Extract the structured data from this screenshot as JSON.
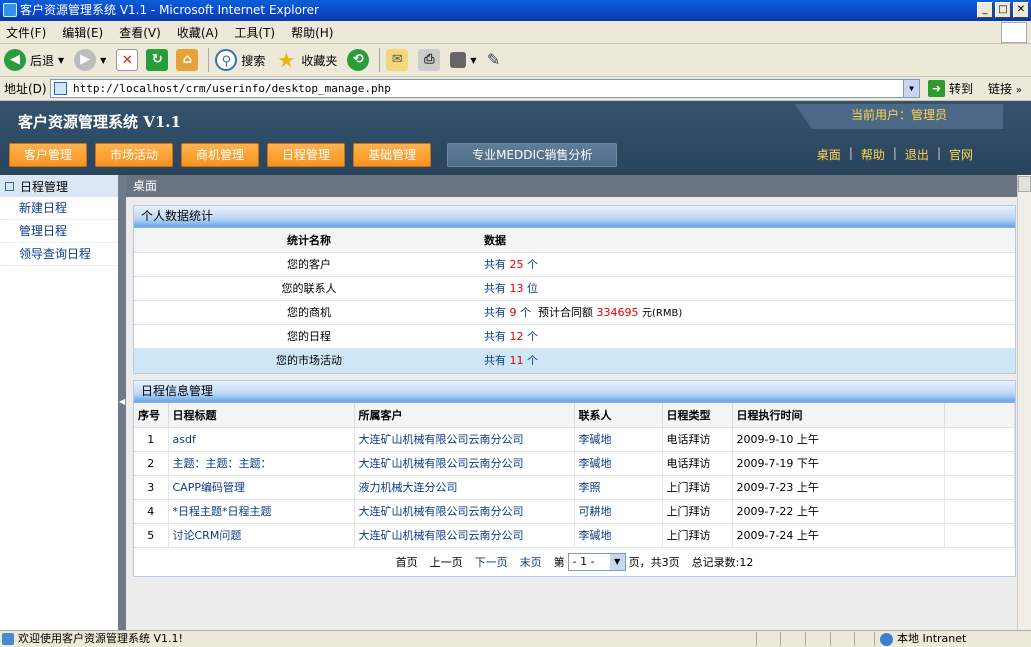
{
  "window": {
    "title": "客户资源管理系统 V1.1 - Microsoft Internet Explorer"
  },
  "menu": [
    "文件(F)",
    "编辑(E)",
    "查看(V)",
    "收藏(A)",
    "工具(T)",
    "帮助(H)"
  ],
  "toolbar": {
    "back": "后退",
    "search": "搜索",
    "favorites": "收藏夹"
  },
  "address": {
    "label": "地址(D)",
    "url": "http://localhost/crm/userinfo/desktop_manage.php",
    "go": "转到",
    "links": "链接"
  },
  "app": {
    "title": "客户资源管理系统 V1.1",
    "current_user": "当前用户：管理员",
    "nav": [
      "客户管理",
      "市场活动",
      "商机管理",
      "日程管理",
      "基础管理",
      "专业MEDDIC销售分析"
    ],
    "top_links": [
      "桌面",
      "帮助",
      "退出",
      "官网"
    ]
  },
  "sidebar": {
    "heading": "日程管理",
    "items": [
      "新建日程",
      "管理日程",
      "领导查询日程"
    ]
  },
  "main": {
    "header": "桌面",
    "stats": {
      "title": "个人数据统计",
      "col_name": "统计名称",
      "col_data": "数据",
      "rows": [
        {
          "name": "您的客户",
          "pre": "共有",
          "num": "25",
          "unit": "个",
          "extra_label": "",
          "extra_value": "",
          "extra_unit": ""
        },
        {
          "name": "您的联系人",
          "pre": "共有",
          "num": "13",
          "unit": "位",
          "extra_label": "",
          "extra_value": "",
          "extra_unit": ""
        },
        {
          "name": "您的商机",
          "pre": "共有",
          "num": "9",
          "unit": "个",
          "extra_label": "预计合同额",
          "extra_value": "334695",
          "extra_unit": "元(RMB)"
        },
        {
          "name": "您的日程",
          "pre": "共有",
          "num": "12",
          "unit": "个",
          "extra_label": "",
          "extra_value": "",
          "extra_unit": ""
        },
        {
          "name": "您的市场活动",
          "pre": "共有",
          "num": "11",
          "unit": "个",
          "extra_label": "",
          "extra_value": "",
          "extra_unit": ""
        }
      ]
    },
    "schedule": {
      "title": "日程信息管理",
      "headers": [
        "序号",
        "日程标题",
        "所属客户",
        "联系人",
        "日程类型",
        "日程执行时间"
      ],
      "rows": [
        {
          "idx": "1",
          "title": "asdf",
          "customer": "大连矿山机械有限公司云南分公司",
          "contact": "李碱地",
          "type": "电话拜访",
          "time": "2009-9-10 上午"
        },
        {
          "idx": "2",
          "title": "主题：主题：主题：",
          "customer": "大连矿山机械有限公司云南分公司",
          "contact": "李碱地",
          "type": "电话拜访",
          "time": "2009-7-19 下午"
        },
        {
          "idx": "3",
          "title": "CAPP编码管理",
          "customer": "液力机械大连分公司",
          "contact": "李照",
          "type": "上门拜访",
          "time": "2009-7-23 上午"
        },
        {
          "idx": "4",
          "title": "*日程主题*日程主题",
          "customer": "大连矿山机械有限公司云南分公司",
          "contact": "可耕地",
          "type": "上门拜访",
          "time": "2009-7-22 上午"
        },
        {
          "idx": "5",
          "title": "讨论CRM问题",
          "customer": "大连矿山机械有限公司云南分公司",
          "contact": "李碱地",
          "type": "上门拜访",
          "time": "2009-7-24 上午"
        }
      ],
      "pager": {
        "first": "首页",
        "prev": "上一页",
        "next": "下一页",
        "last": "末页",
        "page_prefix": "第",
        "page_value": "- 1 -",
        "page_suffix": "页，共3页",
        "total": "总记录数:12"
      }
    }
  },
  "status": {
    "text": "欢迎使用客户资源管理系统 V1.1!",
    "zone": "本地 Intranet"
  }
}
